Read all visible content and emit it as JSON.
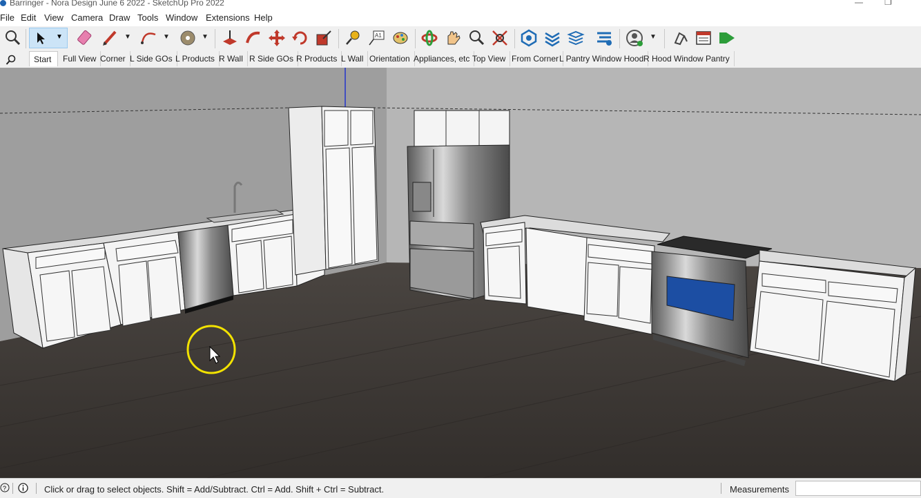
{
  "window": {
    "title": "Barringer - Nora Design June 6 2022 - SketchUp Pro 2022",
    "minimize": "—",
    "restore": "❐"
  },
  "menu": {
    "items": [
      "File",
      "Edit",
      "View",
      "Camera",
      "Draw",
      "Tools",
      "Window",
      "Extensions",
      "Help"
    ]
  },
  "toolbar": {
    "icons": [
      "zoom-window-icon",
      "select-icon",
      "eraser-icon",
      "pencil-icon",
      "arc-icon",
      "paint-bucket-icon",
      "push-pull-icon",
      "follow-me-icon",
      "move-icon",
      "rotate-icon",
      "scale-icon",
      "tape-measure-icon",
      "text-icon",
      "paint-icon",
      "orbit-icon",
      "pan-icon",
      "zoom-icon",
      "zoom-extents-icon",
      "component-icon",
      "sections-icon",
      "layers-icon",
      "outliner-icon",
      "profile-icon",
      "eraser-alt-icon",
      "styles-icon",
      "next-icon"
    ]
  },
  "scenes": {
    "tabs": [
      "Start",
      "Full View",
      "Corner",
      "L Side GOs",
      "L Products",
      "R Wall",
      "R Side GOs",
      "R Products",
      "L Wall",
      "Orientation",
      "Appliances, etc",
      "Top View",
      "From Corner",
      "L Pantry Window Hood",
      "R Hood Window Pantry"
    ],
    "active": "Start"
  },
  "status": {
    "message": "Click or drag to select objects. Shift = Add/Subtract. Ctrl = Add. Shift + Ctrl = Subtract.",
    "measurements_label": "Measurements",
    "measurements_value": ""
  },
  "colors": {
    "wall": "#b3b3b3",
    "floor": "#3a3633",
    "cabinet": "#f4f4f4",
    "oven_glass": "#1c4ea3",
    "cursor_ring": "#f2e200"
  }
}
